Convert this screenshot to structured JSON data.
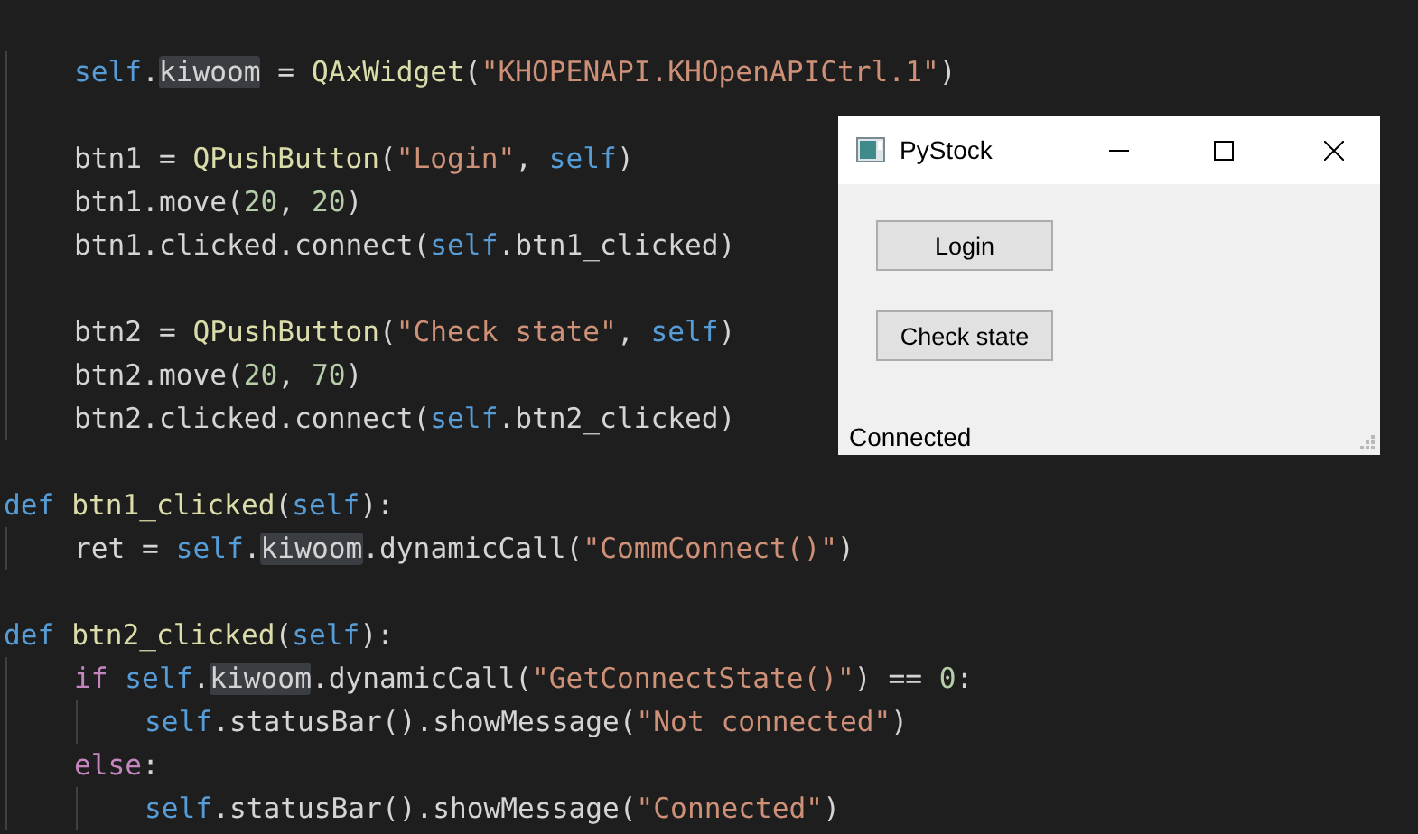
{
  "editor": {
    "lines": [
      {
        "kind": "blank"
      },
      {
        "kind": "group",
        "children": [
          {
            "kind": "code",
            "tokens": [
              {
                "text": "self",
                "kind": "var"
              },
              {
                "text": ".",
                "kind": "plain"
              },
              {
                "text": "kiwoom",
                "kind": "match"
              },
              {
                "text": " = ",
                "kind": "plain"
              },
              {
                "text": "QAxWidget",
                "kind": "fn"
              },
              {
                "text": "(",
                "kind": "plain"
              },
              {
                "text": "\"KHOPENAPI.KHOpenAPICtrl.1\"",
                "kind": "str"
              },
              {
                "text": ")",
                "kind": "plain"
              }
            ]
          },
          {
            "kind": "blank"
          },
          {
            "kind": "code",
            "tokens": [
              {
                "text": "btn1 = ",
                "kind": "plain"
              },
              {
                "text": "QPushButton",
                "kind": "fn"
              },
              {
                "text": "(",
                "kind": "plain"
              },
              {
                "text": "\"Login\"",
                "kind": "str"
              },
              {
                "text": ", ",
                "kind": "plain"
              },
              {
                "text": "self",
                "kind": "var"
              },
              {
                "text": ")",
                "kind": "plain"
              }
            ]
          },
          {
            "kind": "code",
            "tokens": [
              {
                "text": "btn1.move(",
                "kind": "plain"
              },
              {
                "text": "20",
                "kind": "num"
              },
              {
                "text": ", ",
                "kind": "plain"
              },
              {
                "text": "20",
                "kind": "num"
              },
              {
                "text": ")",
                "kind": "plain"
              }
            ]
          },
          {
            "kind": "code",
            "tokens": [
              {
                "text": "btn1.clicked.connect(",
                "kind": "plain"
              },
              {
                "text": "self",
                "kind": "var"
              },
              {
                "text": ".btn1_clicked)",
                "kind": "plain"
              }
            ]
          },
          {
            "kind": "blank"
          },
          {
            "kind": "code",
            "tokens": [
              {
                "text": "btn2 = ",
                "kind": "plain"
              },
              {
                "text": "QPushButton",
                "kind": "fn"
              },
              {
                "text": "(",
                "kind": "plain"
              },
              {
                "text": "\"Check state\"",
                "kind": "str"
              },
              {
                "text": ", ",
                "kind": "plain"
              },
              {
                "text": "self",
                "kind": "var"
              },
              {
                "text": ")",
                "kind": "plain"
              }
            ]
          },
          {
            "kind": "code",
            "tokens": [
              {
                "text": "btn2.move(",
                "kind": "plain"
              },
              {
                "text": "20",
                "kind": "num"
              },
              {
                "text": ", ",
                "kind": "plain"
              },
              {
                "text": "70",
                "kind": "num"
              },
              {
                "text": ")",
                "kind": "plain"
              }
            ]
          },
          {
            "kind": "code",
            "tokens": [
              {
                "text": "btn2.clicked.connect(",
                "kind": "plain"
              },
              {
                "text": "self",
                "kind": "var"
              },
              {
                "text": ".btn2_clicked)",
                "kind": "plain"
              }
            ]
          }
        ]
      },
      {
        "kind": "blank"
      },
      {
        "kind": "code",
        "tokens": [
          {
            "text": "def ",
            "kind": "kw"
          },
          {
            "text": "btn1_clicked",
            "kind": "fn"
          },
          {
            "text": "(",
            "kind": "plain"
          },
          {
            "text": "self",
            "kind": "var"
          },
          {
            "text": "):",
            "kind": "plain"
          }
        ],
        "children": [
          {
            "kind": "code",
            "tokens": [
              {
                "text": "ret = ",
                "kind": "plain"
              },
              {
                "text": "self",
                "kind": "var"
              },
              {
                "text": ".",
                "kind": "plain"
              },
              {
                "text": "kiwoom",
                "kind": "match"
              },
              {
                "text": ".dynamicCall(",
                "kind": "plain"
              },
              {
                "text": "\"CommConnect()\"",
                "kind": "str"
              },
              {
                "text": ")",
                "kind": "plain"
              }
            ]
          }
        ]
      },
      {
        "kind": "blank"
      },
      {
        "kind": "code",
        "tokens": [
          {
            "text": "def ",
            "kind": "kw"
          },
          {
            "text": "btn2_clicked",
            "kind": "fn"
          },
          {
            "text": "(",
            "kind": "plain"
          },
          {
            "text": "self",
            "kind": "var"
          },
          {
            "text": "):",
            "kind": "plain"
          }
        ],
        "children": [
          {
            "kind": "code",
            "tokens": [
              {
                "text": "if ",
                "kind": "ctrl"
              },
              {
                "text": "self",
                "kind": "var"
              },
              {
                "text": ".",
                "kind": "plain"
              },
              {
                "text": "kiwoom",
                "kind": "match"
              },
              {
                "text": ".dynamicCall(",
                "kind": "plain"
              },
              {
                "text": "\"GetConnectState()\"",
                "kind": "str"
              },
              {
                "text": ") == ",
                "kind": "plain"
              },
              {
                "text": "0",
                "kind": "num"
              },
              {
                "text": ":",
                "kind": "plain"
              }
            ],
            "children": [
              {
                "kind": "code",
                "tokens": [
                  {
                    "text": "self",
                    "kind": "var"
                  },
                  {
                    "text": ".statusBar().showMessage(",
                    "kind": "plain"
                  },
                  {
                    "text": "\"Not connected\"",
                    "kind": "str"
                  },
                  {
                    "text": ")",
                    "kind": "plain"
                  }
                ]
              }
            ]
          },
          {
            "kind": "code",
            "tokens": [
              {
                "text": "else",
                "kind": "ctrl"
              },
              {
                "text": ":",
                "kind": "plain"
              }
            ],
            "children": [
              {
                "kind": "code",
                "tokens": [
                  {
                    "text": "self",
                    "kind": "var"
                  },
                  {
                    "text": ".statusBar().showMessage(",
                    "kind": "plain"
                  },
                  {
                    "text": "\"Connected\"",
                    "kind": "str"
                  },
                  {
                    "text": ")",
                    "kind": "plain"
                  }
                ]
              }
            ]
          }
        ]
      }
    ]
  },
  "window": {
    "title": "PyStock",
    "buttons": [
      {
        "label": "Login"
      },
      {
        "label": "Check state"
      }
    ],
    "status": "Connected"
  }
}
